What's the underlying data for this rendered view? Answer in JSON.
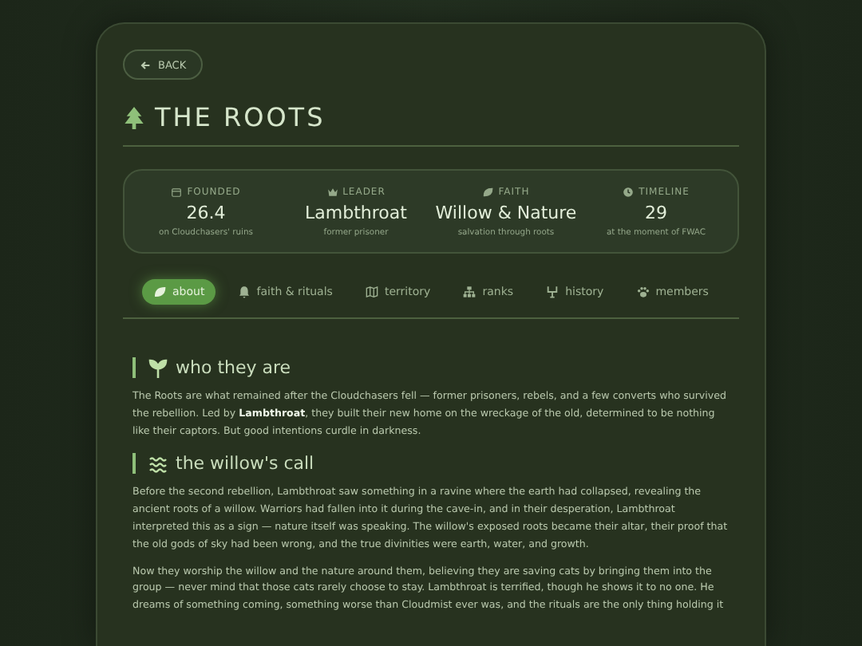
{
  "back_button": {
    "label": "BACK"
  },
  "title": "THE ROOTS",
  "stats": [
    {
      "kind": "calendar",
      "label": "FOUNDED",
      "value": "26.4",
      "note": "on Cloudchasers' ruins"
    },
    {
      "kind": "crown",
      "label": "LEADER",
      "value": "Lambthroat",
      "note": "former prisoner"
    },
    {
      "kind": "leaf",
      "label": "FAITH",
      "value": "Willow & Nature",
      "note": "salvation through roots"
    },
    {
      "kind": "clock",
      "label": "TIMELINE",
      "value": "29",
      "note": "at the moment of FWAC"
    }
  ],
  "tabs": [
    {
      "kind": "leaf",
      "label": "about",
      "selected": true
    },
    {
      "kind": "bell",
      "label": "faith & rituals",
      "selected": false
    },
    {
      "kind": "map",
      "label": "territory",
      "selected": false
    },
    {
      "kind": "ranks",
      "label": "ranks",
      "selected": false
    },
    {
      "kind": "history",
      "label": "history",
      "selected": false
    },
    {
      "kind": "paw",
      "label": "members",
      "selected": false
    }
  ],
  "sections": [
    {
      "kind": "seedling",
      "heading": "who they are",
      "paragraphs": [
        "The Roots are what remained after the Cloudchasers fell — former prisoners, rebels, and a few converts who survived the rebellion. Led by **Lambthroat**, they built their new home on the wreckage of the old, determined to be nothing like their captors. But good intentions curdle in darkness."
      ]
    },
    {
      "kind": "water",
      "heading": "the willow's call",
      "paragraphs": [
        "Before the second rebellion, Lambthroat saw something in a ravine where the earth had collapsed, revealing the ancient roots of a willow. Warriors had fallen into it during the cave-in, and in their desperation, Lambthroat interpreted this as a sign — nature itself was speaking. The willow's exposed roots became their altar, their proof that the old gods of sky had been wrong, and the true divinities were earth, water, and growth.",
        "Now they worship the willow and the nature around them, believing they are saving cats by bringing them into the group — never mind that those cats rarely choose to stay. Lambthroat is terrified, though he shows it to no one. He dreams of something coming, something worse than Cloudmist ever was, and the rituals are the only thing holding it"
      ]
    }
  ]
}
